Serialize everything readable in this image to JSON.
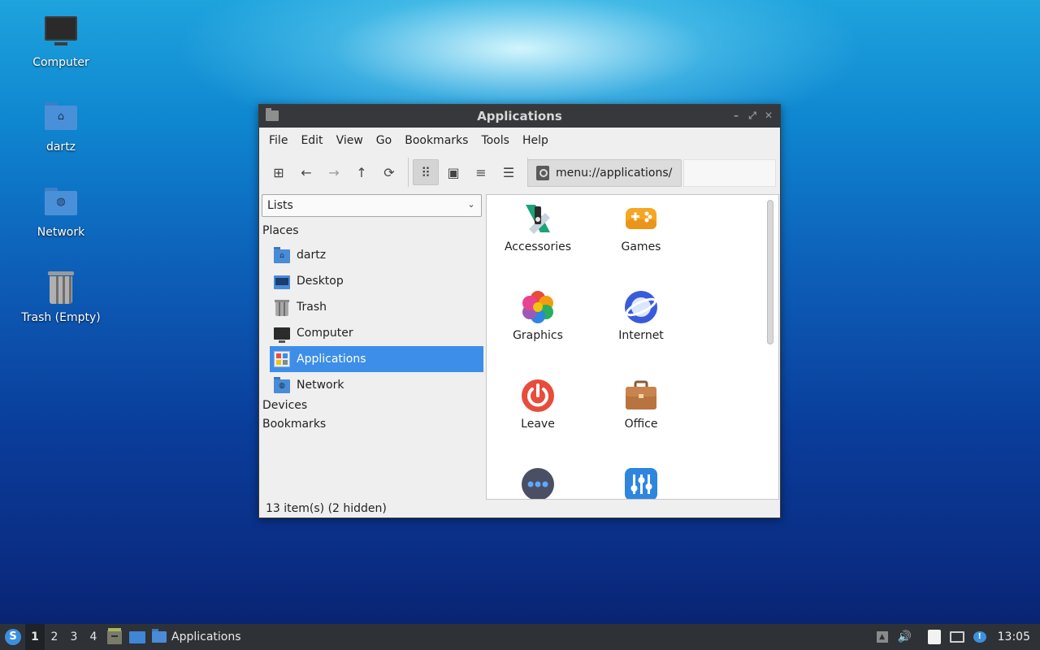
{
  "desktop": {
    "icons": [
      {
        "label": "Computer"
      },
      {
        "label": "dartz"
      },
      {
        "label": "Network"
      },
      {
        "label": "Trash (Empty)"
      }
    ]
  },
  "window": {
    "title": "Applications",
    "controls": {
      "minimize": "–",
      "maximize": "⤢",
      "close": "✕"
    },
    "menu": [
      "File",
      "Edit",
      "View",
      "Go",
      "Bookmarks",
      "Tools",
      "Help"
    ],
    "toolbar": {
      "icons": {
        "new_tab": "⊞",
        "back": "←",
        "forward": "→",
        "up": "↑",
        "reload": "⟳",
        "icon_view": "⠿",
        "thumbnail_view": "▣",
        "compact_view": "≡",
        "detailed_view": "☰"
      },
      "location": "menu://applications/"
    },
    "sidebar": {
      "selector": "Lists",
      "places_heading": "Places",
      "places": [
        {
          "label": "dartz"
        },
        {
          "label": "Desktop"
        },
        {
          "label": "Trash"
        },
        {
          "label": "Computer"
        },
        {
          "label": "Applications"
        },
        {
          "label": "Network"
        }
      ],
      "devices_heading": "Devices",
      "bookmarks_heading": "Bookmarks"
    },
    "content": {
      "items": [
        {
          "label": "Accessories"
        },
        {
          "label": "Games"
        },
        {
          "label": "Graphics"
        },
        {
          "label": "Internet"
        },
        {
          "label": "Leave"
        },
        {
          "label": "Office"
        },
        {
          "label": ""
        },
        {
          "label": ""
        }
      ]
    },
    "status": "13 item(s) (2 hidden)"
  },
  "taskbar": {
    "start_glyph": "S",
    "workspaces": [
      "1",
      "2",
      "3",
      "4"
    ],
    "active_task": "Applications",
    "tray": {
      "up_arrow": "▲",
      "volume": "🔊",
      "update_badge": "!"
    },
    "clock": "13:05"
  },
  "colors": {
    "selection": "#3d8ee8",
    "titlebar": "#36383c",
    "taskbar": "#2e3136"
  }
}
